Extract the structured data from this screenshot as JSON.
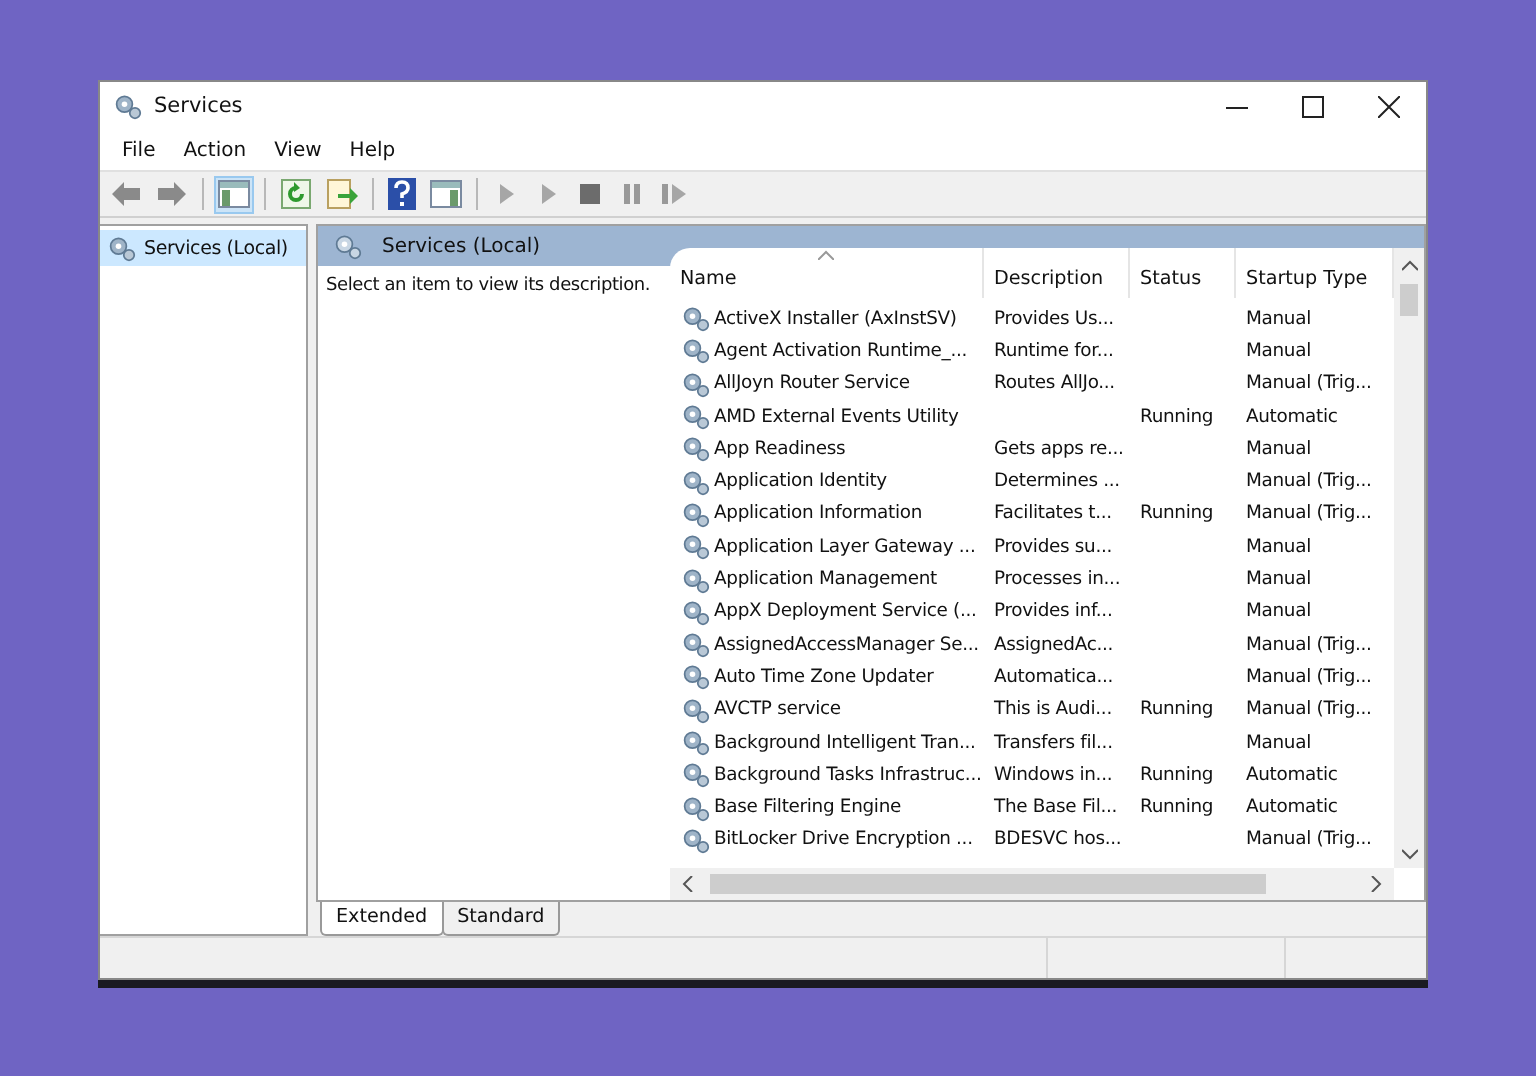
{
  "window": {
    "title": "Services"
  },
  "menu": [
    "File",
    "Action",
    "View",
    "Help"
  ],
  "toolbar": [
    {
      "kind": "back",
      "disabled": false
    },
    {
      "kind": "forward",
      "disabled": false
    },
    {
      "kind": "sep"
    },
    {
      "kind": "tree",
      "selected": true
    },
    {
      "kind": "sep"
    },
    {
      "kind": "refresh"
    },
    {
      "kind": "export"
    },
    {
      "kind": "sep"
    },
    {
      "kind": "help"
    },
    {
      "kind": "props"
    },
    {
      "kind": "sep"
    },
    {
      "kind": "start",
      "disabled": true
    },
    {
      "kind": "start",
      "disabled": true
    },
    {
      "kind": "stop",
      "disabled": true
    },
    {
      "kind": "pause",
      "disabled": true
    },
    {
      "kind": "resume",
      "disabled": true
    }
  ],
  "tree": [
    {
      "label": "Services (Local)",
      "selected": true
    }
  ],
  "panel": {
    "title": "Services (Local)",
    "description": "Select an item to view its description."
  },
  "table": {
    "columns": [
      {
        "label": "Name",
        "sorted": true
      },
      {
        "label": "Description",
        "sorted": false
      },
      {
        "label": "Status",
        "sorted": false
      },
      {
        "label": "Startup Type",
        "sorted": false
      }
    ],
    "rows": [
      [
        "ActiveX Installer (AxInstSV)",
        "Provides Us...",
        "",
        "Manual"
      ],
      [
        "Agent Activation Runtime_...",
        "Runtime for...",
        "",
        "Manual"
      ],
      [
        "AllJoyn Router Service",
        "Routes AllJo...",
        "",
        "Manual (Trig..."
      ],
      [
        "AMD External Events Utility",
        "",
        "Running",
        "Automatic"
      ],
      [
        "App Readiness",
        "Gets apps re...",
        "",
        "Manual"
      ],
      [
        "Application Identity",
        "Determines ...",
        "",
        "Manual (Trig..."
      ],
      [
        "Application Information",
        "Facilitates t...",
        "Running",
        "Manual (Trig..."
      ],
      [
        "Application Layer Gateway ...",
        "Provides su...",
        "",
        "Manual"
      ],
      [
        "Application Management",
        "Processes in...",
        "",
        "Manual"
      ],
      [
        "AppX Deployment Service (...",
        "Provides inf...",
        "",
        "Manual"
      ],
      [
        "AssignedAccessManager Se...",
        "AssignedAc...",
        "",
        "Manual (Trig..."
      ],
      [
        "Auto Time Zone Updater",
        "Automatica...",
        "",
        "Manual (Trig..."
      ],
      [
        "AVCTP service",
        "This is Audi...",
        "Running",
        "Manual (Trig..."
      ],
      [
        "Background Intelligent Tran...",
        "Transfers fil...",
        "",
        "Manual"
      ],
      [
        "Background Tasks Infrastruc...",
        "Windows in...",
        "Running",
        "Automatic"
      ],
      [
        "Base Filtering Engine",
        "The Base Fil...",
        "Running",
        "Automatic"
      ],
      [
        "BitLocker Drive Encryption ...",
        "BDESVC hos...",
        "",
        "Manual (Trig..."
      ]
    ]
  },
  "tabs": [
    {
      "label": "Extended",
      "selected": true
    },
    {
      "label": "Standard",
      "selected": false
    }
  ]
}
